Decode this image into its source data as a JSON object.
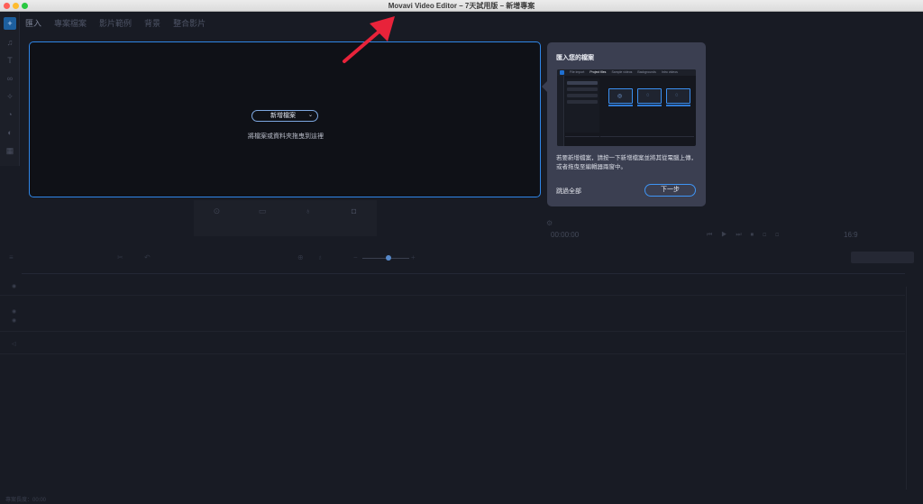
{
  "window": {
    "title": "Movavi Video Editor – 7天試用版 – 新增專案"
  },
  "tabs": [
    {
      "label": "匯入"
    },
    {
      "label": "專案檔案"
    },
    {
      "label": "影片範例"
    },
    {
      "label": "背景"
    },
    {
      "label": "整合影片"
    }
  ],
  "import_panel": {
    "add_button_label": "新增檔案",
    "drop_hint": "將檔案或資料夾拖曳到這裡"
  },
  "tour": {
    "title": "匯入您的檔案",
    "preview_tabs": [
      "File import",
      "Project files",
      "Sample videos",
      "Backgrounds",
      "Intro videos"
    ],
    "body": "若要新增檔案，請按一下新增檔案並將其從電腦上傳，或者拖曳至編輯器兩窗中。",
    "skip_label": "跳過全部",
    "next_label": "下一步"
  },
  "player": {
    "time": "00:00:00",
    "ratio": "16:9"
  },
  "status": {
    "label": "專案長度：00:00"
  },
  "colors": {
    "accent": "#2f86e8",
    "annotation": "#e8233a",
    "tooltip_bg": "#3b3f51"
  }
}
